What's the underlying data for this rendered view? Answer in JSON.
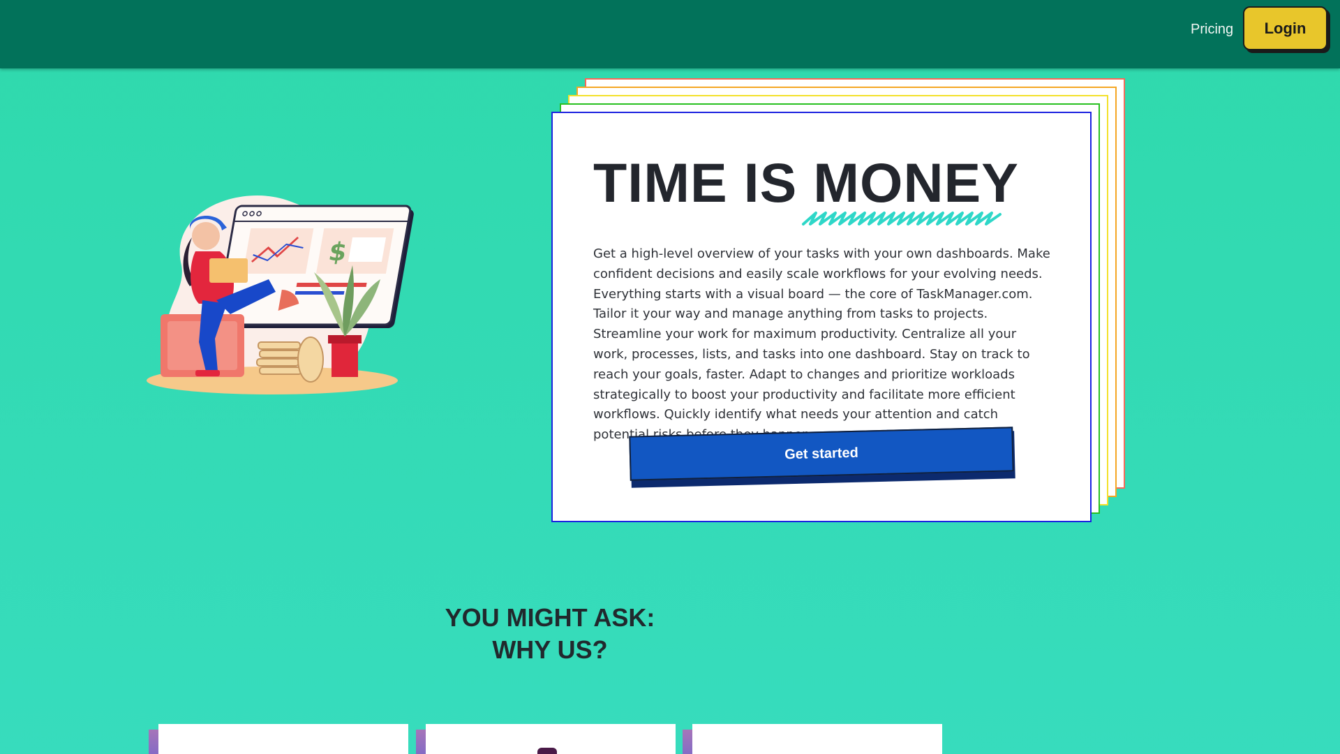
{
  "nav": {
    "pricing_label": "Pricing",
    "login_label": "Login"
  },
  "hero": {
    "title": "TIME IS MONEY",
    "body": "Get a high-level overview of your tasks with your own dashboards. Make confident decisions and easily scale workflows for your evolving needs. Everything starts with a visual board — the core of TaskManager.com. Tailor it your way and manage anything from tasks to projects. Streamline your work for maximum productivity. Centralize all your work, processes, lists, and tasks into one dashboard. Stay on track to reach your goals, faster. Adapt to changes and prioritize workloads strategically to boost your productivity and facilitate more efficient workflows. Quickly identify what needs your attention and catch potential risks before they happen.",
    "cta_label": "Get started"
  },
  "section": {
    "title_line1": "YOU MIGHT ASK:",
    "title_line2": "WHY US?"
  },
  "colors": {
    "header_bg": "#02725a",
    "page_bg": "#2fd9ac",
    "login_bg": "#e8c62b",
    "cta_bg": "#1257c2",
    "card_border": "#1b22e0",
    "frame_colors": [
      "#f7695a",
      "#f5a623",
      "#f3e12b",
      "#28c020"
    ]
  }
}
